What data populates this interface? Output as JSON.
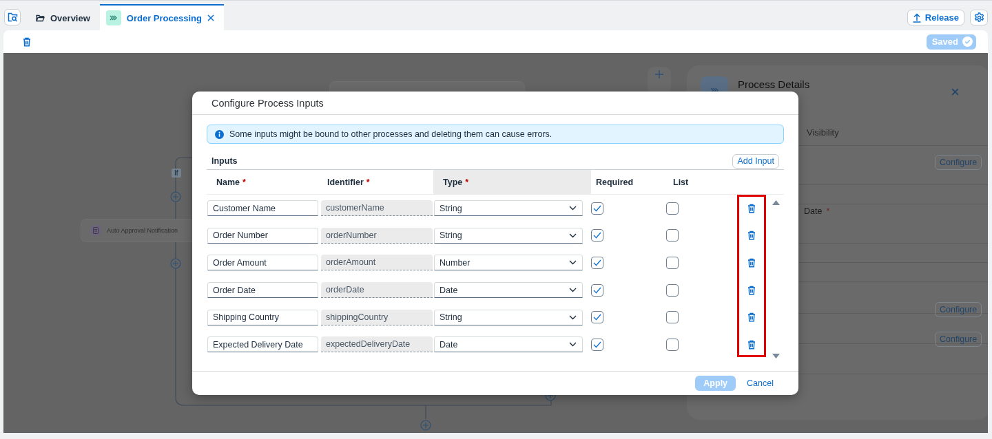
{
  "header": {
    "tabs": [
      {
        "label": "Overview",
        "selected": false
      },
      {
        "label": "Order Processing",
        "selected": true
      }
    ],
    "release_button": "Release"
  },
  "toolbar": {
    "status_button": "Saved"
  },
  "canvas": {
    "branch_label": "If",
    "nodes": [
      {
        "label": "Auto Approval Notification"
      }
    ]
  },
  "details_panel": {
    "title": "Process Details",
    "tab": "Visibility",
    "field_label": "Date",
    "required_mark": "*",
    "buttons": [
      "Configure",
      "Configure",
      "Configure"
    ]
  },
  "dialog": {
    "title": "Configure Process Inputs",
    "message": "Some inputs might be bound to other processes and deleting them can cause errors.",
    "section_title": "Inputs",
    "add_button": "Add Input",
    "required_mark": "*",
    "columns": [
      {
        "label": "Name",
        "required": true,
        "highlighted": false
      },
      {
        "label": "Identifier",
        "required": true,
        "highlighted": false
      },
      {
        "label": "Type",
        "required": true,
        "highlighted": true
      },
      {
        "label": "Required",
        "required": false,
        "highlighted": false
      },
      {
        "label": "List",
        "required": false,
        "highlighted": false
      }
    ],
    "rows": [
      {
        "name": "Customer Name",
        "identifier": "customerName",
        "type": "String",
        "required": true,
        "list": false
      },
      {
        "name": "Order Number",
        "identifier": "orderNumber",
        "type": "String",
        "required": true,
        "list": false
      },
      {
        "name": "Order Amount",
        "identifier": "orderAmount",
        "type": "Number",
        "required": true,
        "list": false
      },
      {
        "name": "Order Date",
        "identifier": "orderDate",
        "type": "Date",
        "required": true,
        "list": false
      },
      {
        "name": "Shipping Country",
        "identifier": "shippingCountry",
        "type": "String",
        "required": true,
        "list": false
      },
      {
        "name": "Expected Delivery Date",
        "identifier": "expectedDeliveryDate",
        "type": "Date",
        "required": true,
        "list": false
      }
    ],
    "apply_button": {
      "label": "Apply",
      "disabled": true
    },
    "cancel_button": "Cancel"
  }
}
